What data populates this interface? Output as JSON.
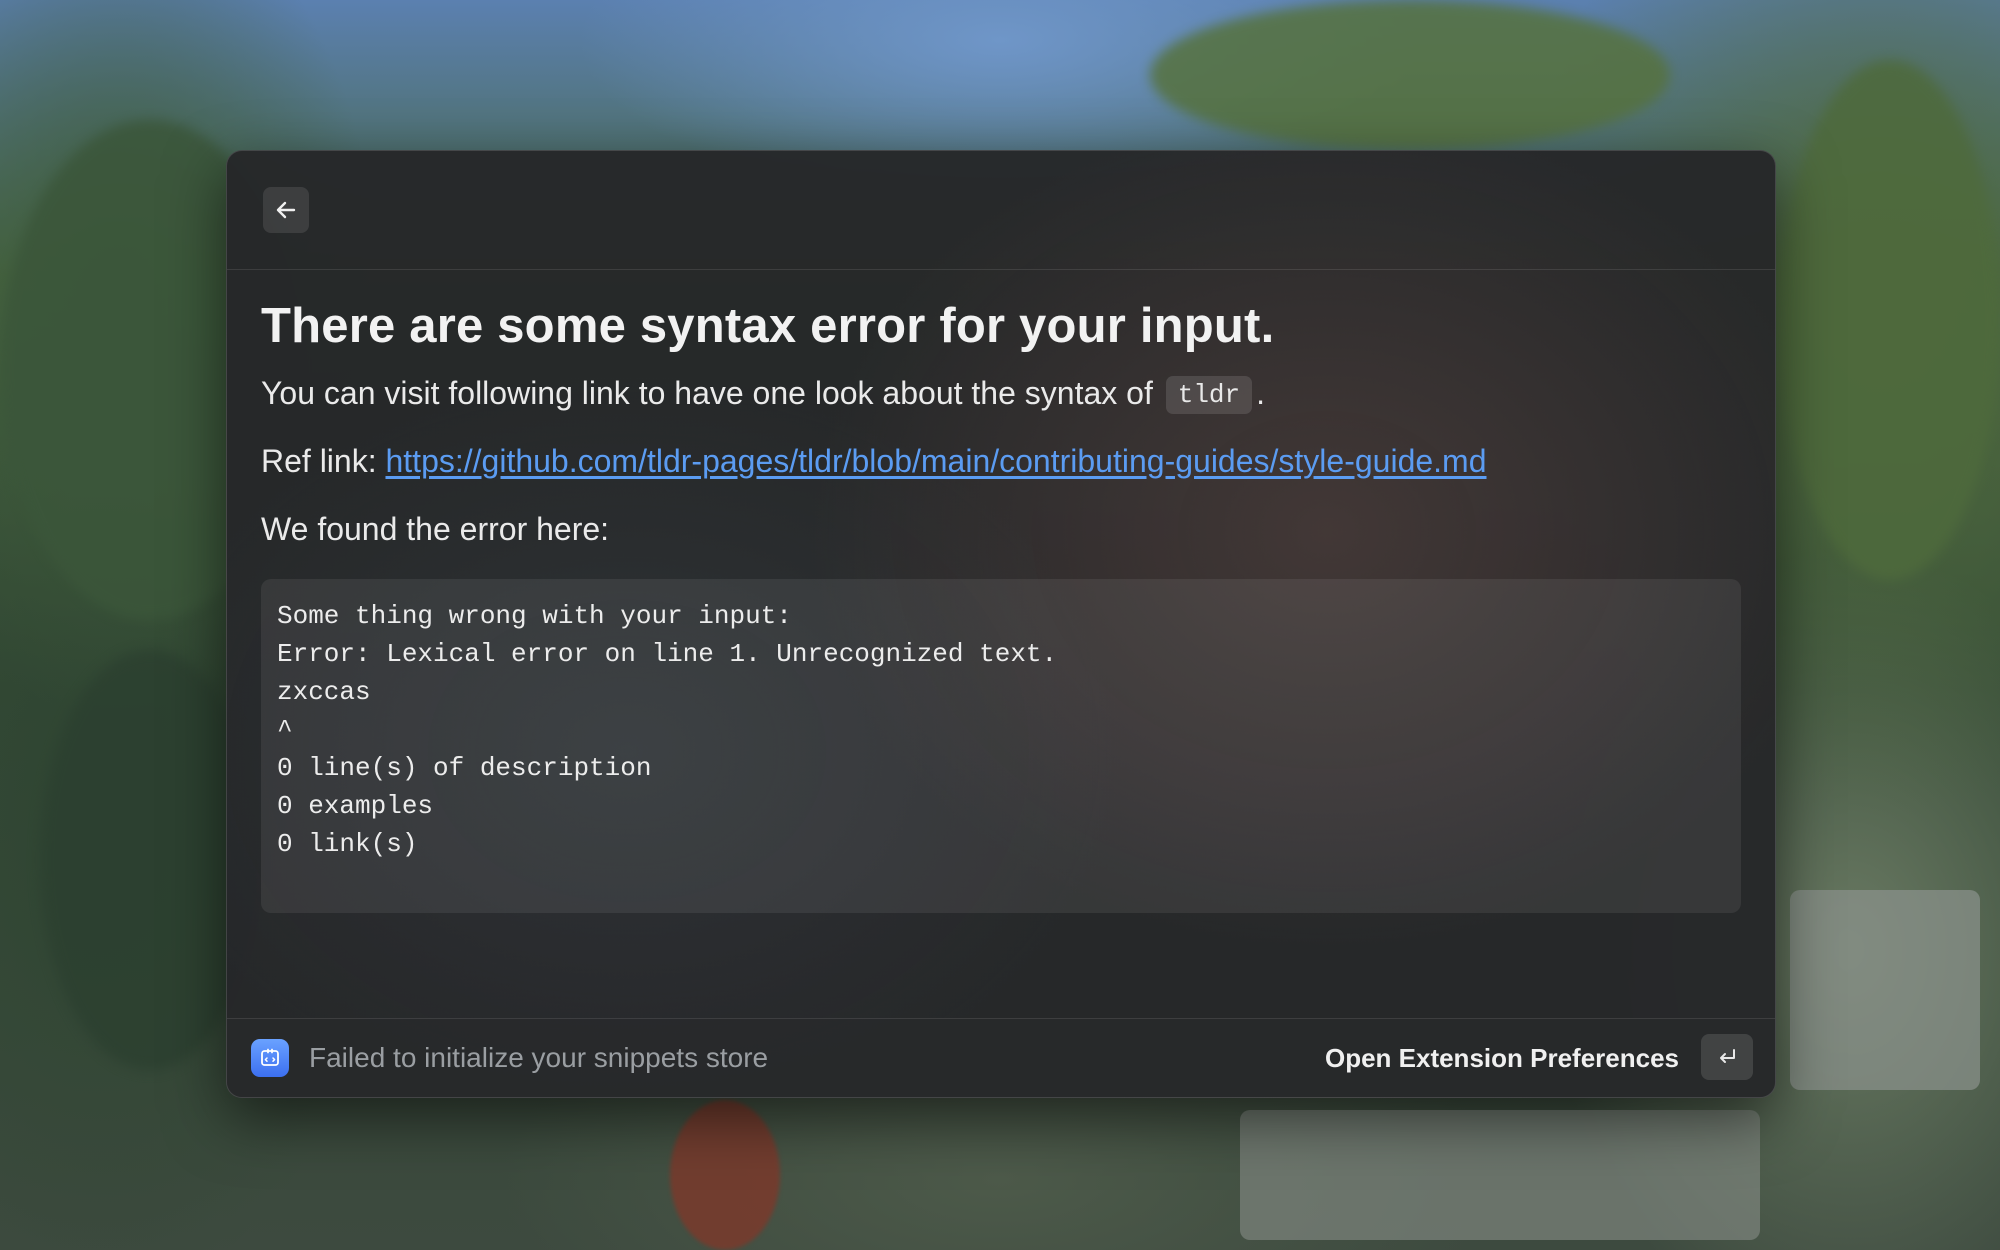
{
  "header": {
    "back_icon": "arrow-left-icon"
  },
  "main": {
    "title": "There are some syntax error for your input.",
    "syntax_text_before": "You can visit following link to have one look about the syntax of",
    "syntax_code": "tldr",
    "syntax_text_after": ".",
    "ref_label": "Ref link: ",
    "ref_url": "https://github.com/tldr-pages/tldr/blob/main/contributing-guides/style-guide.md",
    "found_label": "We found the error here:",
    "error_lines": [
      "Some thing wrong with your input:",
      "Error: Lexical error on line 1. Unrecognized text.",
      "zxccas",
      "^",
      "0 line(s) of description",
      "0 examples",
      "0 link(s)"
    ]
  },
  "footer": {
    "extension_icon": "snippets-extension-icon",
    "status": "Failed to initialize your snippets store",
    "action_label": "Open Extension Preferences",
    "action_key_icon": "return-key-icon"
  },
  "colors": {
    "link": "#5b9cf2",
    "extension_icon": "#4a80f5",
    "window_bg": "#252729"
  }
}
